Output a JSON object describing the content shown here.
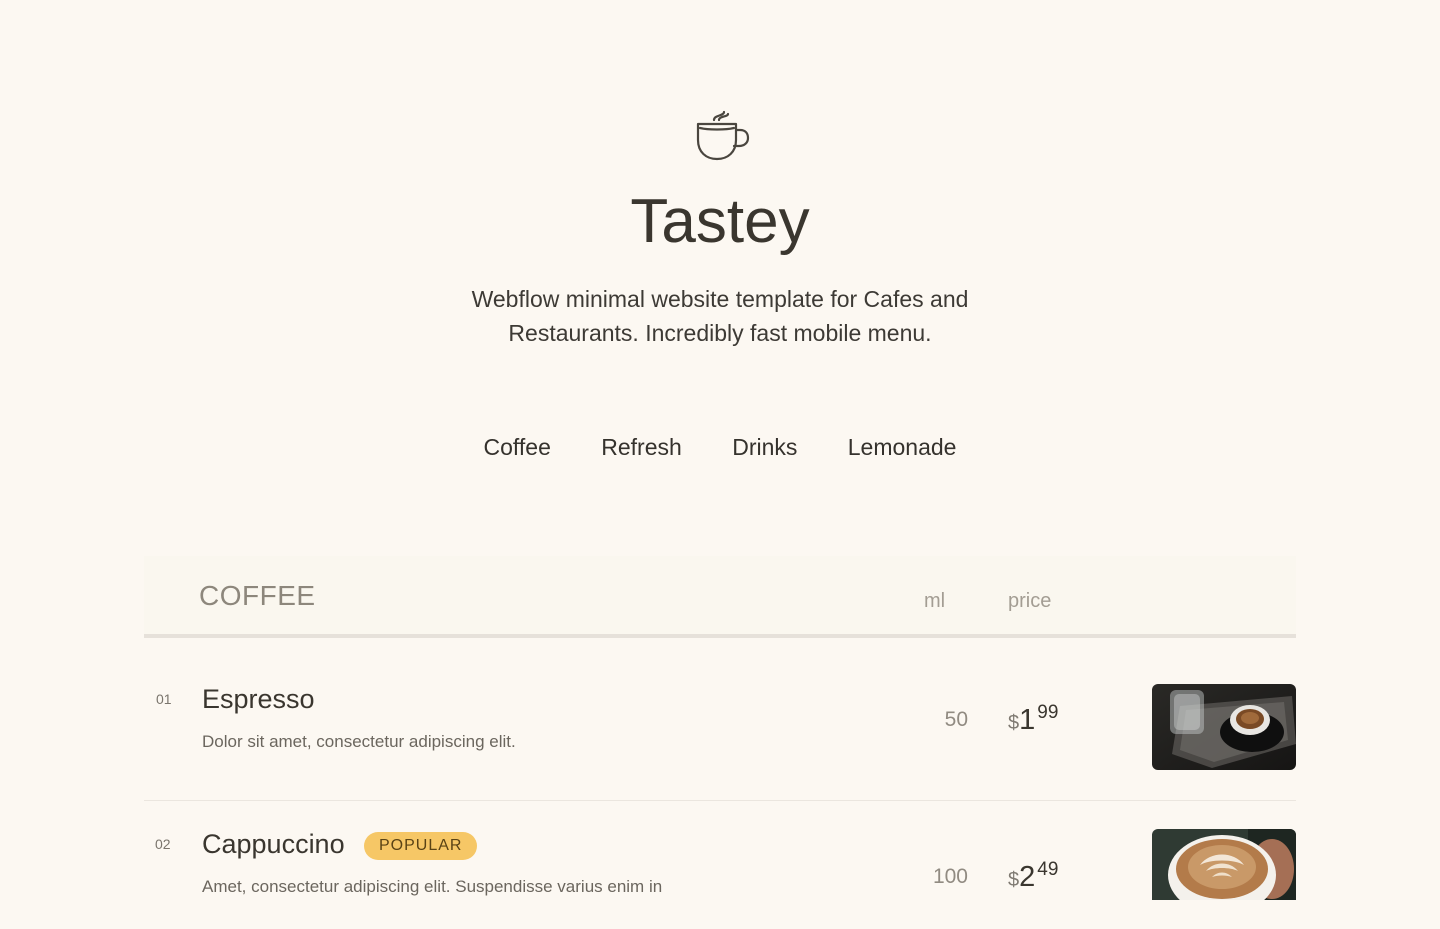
{
  "brand": {
    "logo_icon": "coffee-cup-icon",
    "title": "Tastey",
    "subtitle": "Webflow minimal website template for Cafes and Restaurants. Incredibly fast mobile menu."
  },
  "nav": {
    "items": [
      "Coffee",
      "Refresh",
      "Drinks",
      "Lemonade"
    ]
  },
  "menu": {
    "category": "COFFEE",
    "col_ml": "ml",
    "col_price": "price",
    "items": [
      {
        "num": "01",
        "name": "Espresso",
        "desc": "Dolor sit amet, consectetur adipiscing elit.",
        "ml": "50",
        "currency": "$",
        "price_whole": "1",
        "price_cents": "99",
        "image": "espresso-cup-photo"
      },
      {
        "num": "02",
        "name": "Cappuccino",
        "badge": "POPULAR",
        "desc": "Amet, consectetur adipiscing elit. Suspendisse varius enim in",
        "ml": "100",
        "currency": "$",
        "price_whole": "2",
        "price_cents": "49",
        "image": "cappuccino-latte-art-photo"
      }
    ]
  },
  "colors": {
    "background": "#fcf8f2",
    "badge": "#f6c766",
    "text": "#3a362f"
  }
}
